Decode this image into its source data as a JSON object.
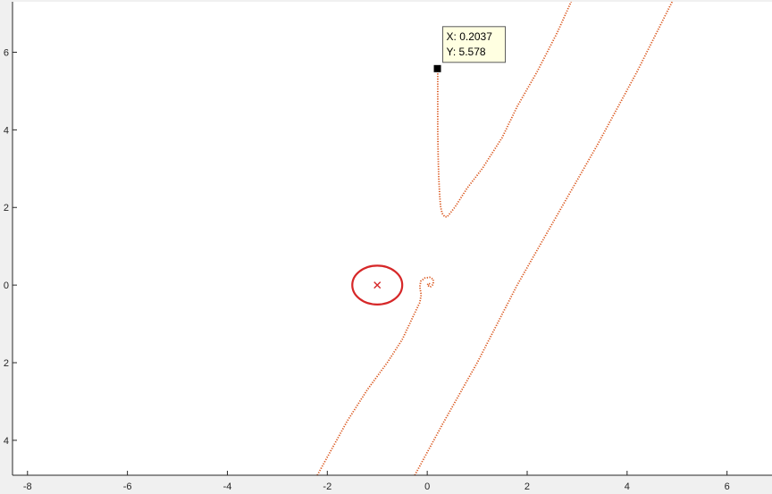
{
  "colors": {
    "figure_bg": "#f0f0f0",
    "axes_bg": "#ffffff",
    "axis": "#262626",
    "curve": "#d95319",
    "circle": "#d62728",
    "tooltip_bg": "#ffffe1",
    "marker": "#000000"
  },
  "chart_data": {
    "type": "line",
    "title": "",
    "xlabel": "",
    "ylabel": "",
    "xlim": [
      -8.3,
      6.9
    ],
    "ylim": [
      -4.9,
      7.3
    ],
    "grid": false,
    "xticks": [
      -8,
      -6,
      -4,
      -2,
      0,
      2,
      4,
      6
    ],
    "xtick_labels": [
      "-8",
      "-6",
      "-4",
      "-2",
      "0",
      "2",
      "4",
      "6"
    ],
    "yticks": [
      -4,
      -2,
      0,
      2,
      4,
      6
    ],
    "ytick_labels": [
      "4",
      "2",
      "0",
      "2",
      "4",
      "6"
    ],
    "series": [
      {
        "style": "dotted",
        "color": "#d95319",
        "x": [
          0.21,
          0.21,
          0.21,
          0.22,
          0.23,
          0.25,
          0.27,
          0.3,
          0.35,
          0.4,
          0.55,
          0.8,
          1.1,
          1.5,
          1.8,
          2.2,
          2.6,
          2.88
        ],
        "y": [
          5.58,
          4.8,
          4.0,
          3.3,
          2.8,
          2.3,
          2.0,
          1.85,
          1.76,
          1.76,
          2.0,
          2.5,
          3.0,
          3.8,
          4.6,
          5.5,
          6.5,
          7.3
        ]
      },
      {
        "style": "dotted",
        "color": "#d95319",
        "x": [
          -2.2,
          -1.9,
          -1.6,
          -1.2,
          -0.8,
          -0.5,
          -0.28,
          -0.15,
          -0.12,
          -0.15,
          -0.13,
          -0.05,
          0.05,
          0.12,
          0.12,
          0.06,
          0.0,
          0.03,
          0.06
        ],
        "y": [
          -4.9,
          -4.2,
          -3.5,
          -2.7,
          -2.0,
          -1.4,
          -0.8,
          -0.45,
          -0.25,
          -0.05,
          0.1,
          0.18,
          0.2,
          0.15,
          0.02,
          -0.05,
          0.0,
          0.05,
          0.02
        ]
      },
      {
        "style": "dotted",
        "color": "#d95319",
        "x": [
          -0.25,
          0.3,
          1.0,
          1.8,
          2.6,
          3.4,
          4.2,
          4.9
        ],
        "y": [
          -4.9,
          -3.6,
          -2.0,
          0.0,
          1.8,
          3.6,
          5.5,
          7.3
        ]
      },
      {
        "style": "solid-circle",
        "color": "#d62728",
        "center": [
          -1.0,
          0.0
        ],
        "radius_x": 0.5,
        "radius_y": 0.5
      }
    ],
    "markers": [
      {
        "shape": "x",
        "x": -1.0,
        "y": 0.0,
        "color": "#d62728"
      },
      {
        "shape": "square",
        "x": 0.2037,
        "y": 5.578,
        "color": "#000000"
      }
    ],
    "annotations": [
      {
        "type": "datatip",
        "x": 0.2037,
        "y": 5.578,
        "lines": [
          "X: 0.2037",
          "Y: 5.578"
        ]
      }
    ]
  }
}
